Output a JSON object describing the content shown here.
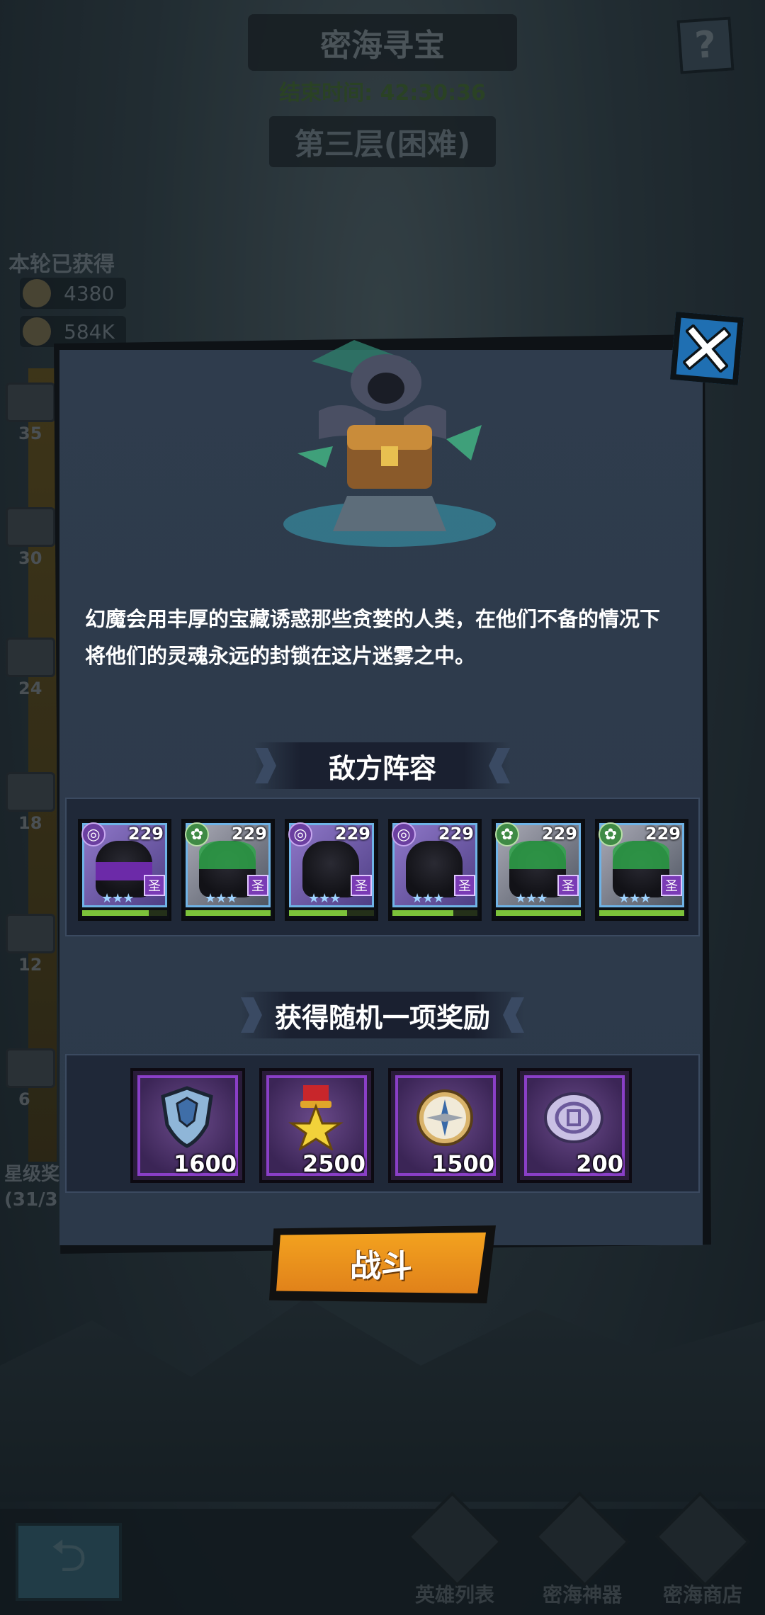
{
  "header": {
    "title": "密海寻宝",
    "end_time_label": "结束时间:",
    "end_time_value": "42:30:36",
    "floor": "第三层(困难)"
  },
  "side": {
    "round_label": "本轮已获得",
    "resources": [
      {
        "icon": "skull-coin-icon",
        "value": "4380"
      },
      {
        "icon": "gold-coin-icon",
        "value": "584K"
      }
    ],
    "milestones": [
      "35",
      "30",
      "24",
      "18",
      "12",
      "6"
    ],
    "star_grade_label": "星级奖",
    "star_grade_value": "(31/3"
  },
  "modal": {
    "description": "幻魔会用丰厚的宝藏诱惑那些贪婪的人类，在他们不备的情况下将他们的灵魂永远的封锁在这片迷雾之中。",
    "enemy_section_title": "敌方阵容",
    "enemies": [
      {
        "level": "229",
        "faction": "dark",
        "rank": "圣",
        "stars": "★★★"
      },
      {
        "level": "229",
        "faction": "nature",
        "rank": "圣",
        "stars": "★★★"
      },
      {
        "level": "229",
        "faction": "dark",
        "rank": "圣",
        "stars": "★★★"
      },
      {
        "level": "229",
        "faction": "dark",
        "rank": "圣",
        "stars": "★★★"
      },
      {
        "level": "229",
        "faction": "nature",
        "rank": "圣",
        "stars": "★★★"
      },
      {
        "level": "229",
        "faction": "nature",
        "rank": "圣",
        "stars": "★★★"
      }
    ],
    "reward_section_title": "获得随机一项奖励",
    "rewards": [
      {
        "icon": "shield-emblem-icon",
        "qty": "1600"
      },
      {
        "icon": "star-medal-icon",
        "qty": "2500"
      },
      {
        "icon": "compass-icon",
        "qty": "1500"
      },
      {
        "icon": "silver-coin-icon",
        "qty": "200"
      }
    ],
    "fight_label": "战斗"
  },
  "bottom_nav": {
    "back_icon": "return-arrow-icon",
    "items": [
      {
        "label": "英雄列表"
      },
      {
        "label": "密海神器"
      },
      {
        "label": "密海商店"
      }
    ]
  },
  "colors": {
    "accent_orange": "#f3a21f",
    "modal_bg": "#2f3c4d",
    "close_blue": "#1f6fb2",
    "hp_green": "#7cc23a",
    "reward_purple": "#8a3fc7"
  }
}
